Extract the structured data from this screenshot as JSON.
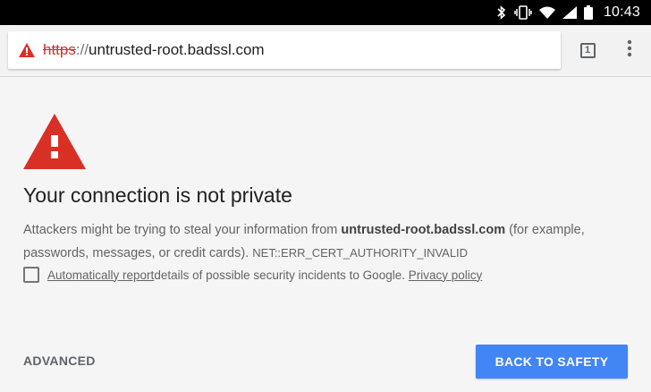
{
  "status_bar": {
    "time": "10:43",
    "icons": [
      "bluetooth-icon",
      "vibrate-icon",
      "wifi-icon",
      "signal-icon",
      "battery-icon"
    ]
  },
  "toolbar": {
    "url_scheme": "https",
    "url_separator": "://",
    "url_host": "untrusted-root.badssl.com",
    "tab_count": "1",
    "security_icon": "warning-triangle-icon",
    "menu_icon": "more-vert-icon"
  },
  "interstitial": {
    "headline": "Your connection is not private",
    "explanation_prefix": "Attackers might be trying to steal your information from ",
    "explanation_host": "untrusted-root.badssl.com",
    "explanation_suffix": " (for example, passwords, messages, or credit cards).",
    "error_code": "NET::ERR_CERT_AUTHORITY_INVALID",
    "report_link": "Automatically report",
    "report_text": " details of possible security incidents to Google.",
    "privacy_link": "Privacy policy",
    "advanced_label": "ADVANCED",
    "back_label": "BACK TO SAFETY"
  },
  "colors": {
    "warning_red": "#d93025",
    "primary_blue": "#4285f4",
    "background": "#f5f5f5"
  }
}
